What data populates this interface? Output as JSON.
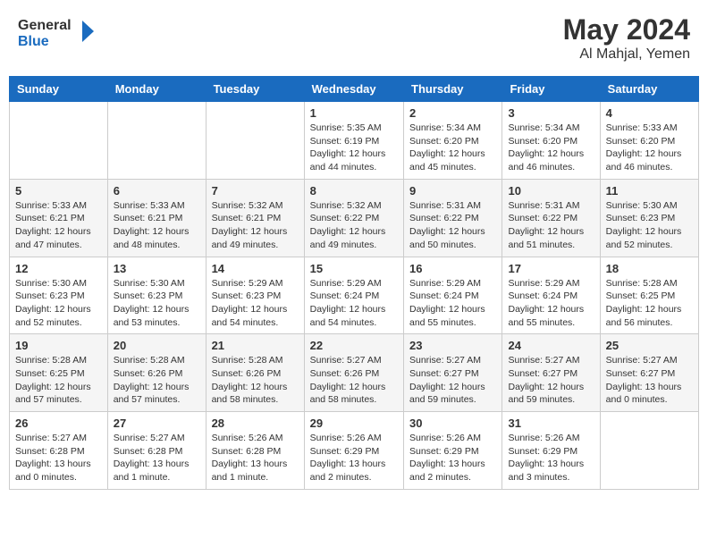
{
  "header": {
    "logo_general": "General",
    "logo_blue": "Blue",
    "month": "May 2024",
    "location": "Al Mahjal, Yemen"
  },
  "weekdays": [
    "Sunday",
    "Monday",
    "Tuesday",
    "Wednesday",
    "Thursday",
    "Friday",
    "Saturday"
  ],
  "weeks": [
    [
      {
        "day": "",
        "info": ""
      },
      {
        "day": "",
        "info": ""
      },
      {
        "day": "",
        "info": ""
      },
      {
        "day": "1",
        "info": "Sunrise: 5:35 AM\nSunset: 6:19 PM\nDaylight: 12 hours\nand 44 minutes."
      },
      {
        "day": "2",
        "info": "Sunrise: 5:34 AM\nSunset: 6:20 PM\nDaylight: 12 hours\nand 45 minutes."
      },
      {
        "day": "3",
        "info": "Sunrise: 5:34 AM\nSunset: 6:20 PM\nDaylight: 12 hours\nand 46 minutes."
      },
      {
        "day": "4",
        "info": "Sunrise: 5:33 AM\nSunset: 6:20 PM\nDaylight: 12 hours\nand 46 minutes."
      }
    ],
    [
      {
        "day": "5",
        "info": "Sunrise: 5:33 AM\nSunset: 6:21 PM\nDaylight: 12 hours\nand 47 minutes."
      },
      {
        "day": "6",
        "info": "Sunrise: 5:33 AM\nSunset: 6:21 PM\nDaylight: 12 hours\nand 48 minutes."
      },
      {
        "day": "7",
        "info": "Sunrise: 5:32 AM\nSunset: 6:21 PM\nDaylight: 12 hours\nand 49 minutes."
      },
      {
        "day": "8",
        "info": "Sunrise: 5:32 AM\nSunset: 6:22 PM\nDaylight: 12 hours\nand 49 minutes."
      },
      {
        "day": "9",
        "info": "Sunrise: 5:31 AM\nSunset: 6:22 PM\nDaylight: 12 hours\nand 50 minutes."
      },
      {
        "day": "10",
        "info": "Sunrise: 5:31 AM\nSunset: 6:22 PM\nDaylight: 12 hours\nand 51 minutes."
      },
      {
        "day": "11",
        "info": "Sunrise: 5:30 AM\nSunset: 6:23 PM\nDaylight: 12 hours\nand 52 minutes."
      }
    ],
    [
      {
        "day": "12",
        "info": "Sunrise: 5:30 AM\nSunset: 6:23 PM\nDaylight: 12 hours\nand 52 minutes."
      },
      {
        "day": "13",
        "info": "Sunrise: 5:30 AM\nSunset: 6:23 PM\nDaylight: 12 hours\nand 53 minutes."
      },
      {
        "day": "14",
        "info": "Sunrise: 5:29 AM\nSunset: 6:23 PM\nDaylight: 12 hours\nand 54 minutes."
      },
      {
        "day": "15",
        "info": "Sunrise: 5:29 AM\nSunset: 6:24 PM\nDaylight: 12 hours\nand 54 minutes."
      },
      {
        "day": "16",
        "info": "Sunrise: 5:29 AM\nSunset: 6:24 PM\nDaylight: 12 hours\nand 55 minutes."
      },
      {
        "day": "17",
        "info": "Sunrise: 5:29 AM\nSunset: 6:24 PM\nDaylight: 12 hours\nand 55 minutes."
      },
      {
        "day": "18",
        "info": "Sunrise: 5:28 AM\nSunset: 6:25 PM\nDaylight: 12 hours\nand 56 minutes."
      }
    ],
    [
      {
        "day": "19",
        "info": "Sunrise: 5:28 AM\nSunset: 6:25 PM\nDaylight: 12 hours\nand 57 minutes."
      },
      {
        "day": "20",
        "info": "Sunrise: 5:28 AM\nSunset: 6:26 PM\nDaylight: 12 hours\nand 57 minutes."
      },
      {
        "day": "21",
        "info": "Sunrise: 5:28 AM\nSunset: 6:26 PM\nDaylight: 12 hours\nand 58 minutes."
      },
      {
        "day": "22",
        "info": "Sunrise: 5:27 AM\nSunset: 6:26 PM\nDaylight: 12 hours\nand 58 minutes."
      },
      {
        "day": "23",
        "info": "Sunrise: 5:27 AM\nSunset: 6:27 PM\nDaylight: 12 hours\nand 59 minutes."
      },
      {
        "day": "24",
        "info": "Sunrise: 5:27 AM\nSunset: 6:27 PM\nDaylight: 12 hours\nand 59 minutes."
      },
      {
        "day": "25",
        "info": "Sunrise: 5:27 AM\nSunset: 6:27 PM\nDaylight: 13 hours\nand 0 minutes."
      }
    ],
    [
      {
        "day": "26",
        "info": "Sunrise: 5:27 AM\nSunset: 6:28 PM\nDaylight: 13 hours\nand 0 minutes."
      },
      {
        "day": "27",
        "info": "Sunrise: 5:27 AM\nSunset: 6:28 PM\nDaylight: 13 hours\nand 1 minute."
      },
      {
        "day": "28",
        "info": "Sunrise: 5:26 AM\nSunset: 6:28 PM\nDaylight: 13 hours\nand 1 minute."
      },
      {
        "day": "29",
        "info": "Sunrise: 5:26 AM\nSunset: 6:29 PM\nDaylight: 13 hours\nand 2 minutes."
      },
      {
        "day": "30",
        "info": "Sunrise: 5:26 AM\nSunset: 6:29 PM\nDaylight: 13 hours\nand 2 minutes."
      },
      {
        "day": "31",
        "info": "Sunrise: 5:26 AM\nSunset: 6:29 PM\nDaylight: 13 hours\nand 3 minutes."
      },
      {
        "day": "",
        "info": ""
      }
    ]
  ]
}
